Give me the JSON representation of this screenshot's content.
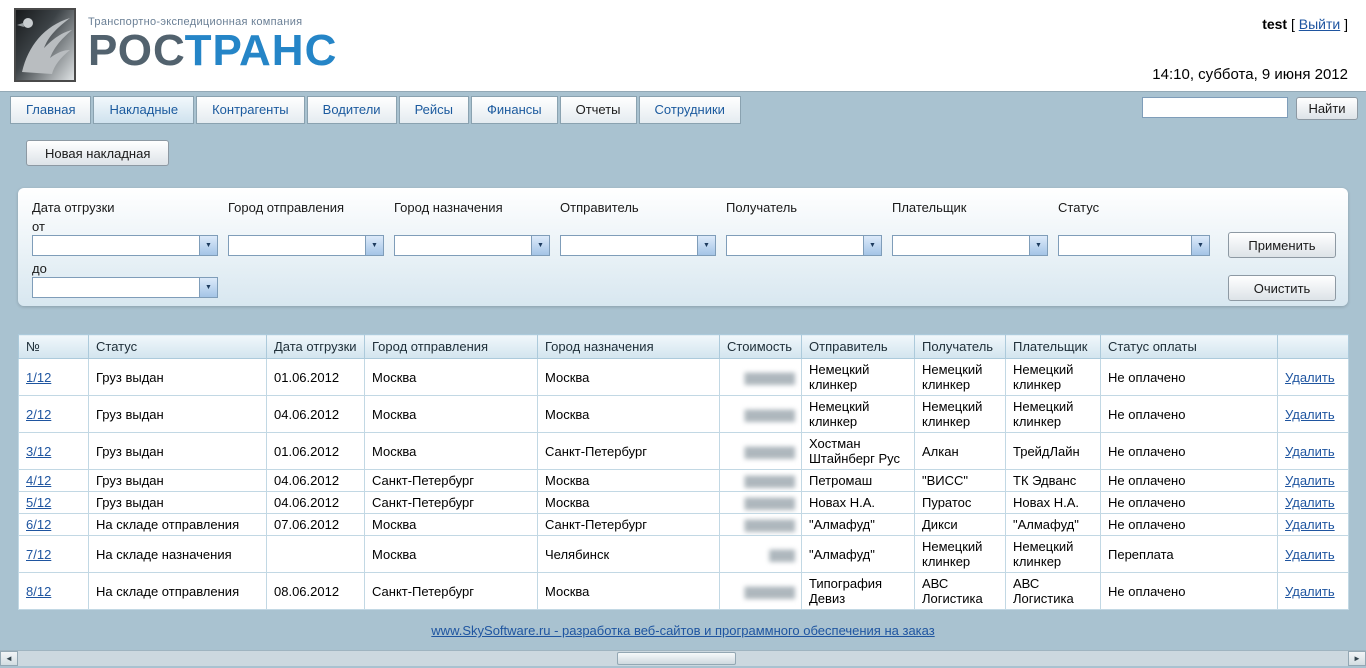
{
  "header": {
    "tagline": "Транспортно-экспедиционная компания",
    "brand_ros": "РОС",
    "brand_trans": "ТРАНС",
    "user": "test",
    "bracket_left": "[",
    "logout_label": "Выйти",
    "bracket_right": "]",
    "datetime": "14:10, суббота, 9 июня 2012"
  },
  "tabs": [
    {
      "label": "Главная"
    },
    {
      "label": "Накладные",
      "active": true
    },
    {
      "label": "Контрагенты"
    },
    {
      "label": "Водители"
    },
    {
      "label": "Рейсы"
    },
    {
      "label": "Финансы"
    },
    {
      "label": "Отчеты"
    },
    {
      "label": "Сотрудники"
    }
  ],
  "search": {
    "value": "",
    "button_label": "Найти"
  },
  "toolbar": {
    "new_invoice_label": "Новая накладная"
  },
  "filters": {
    "date_label": "Дата отгрузки",
    "from_label": "от",
    "to_label": "до",
    "origin_label": "Город отправления",
    "destination_label": "Город назначения",
    "sender_label": "Отправитель",
    "receiver_label": "Получатель",
    "payer_label": "Плательщик",
    "status_label": "Статус",
    "apply_label": "Применить",
    "clear_label": "Очистить"
  },
  "icons": {
    "dropdown_arrow": "▼",
    "scroll_left": "◄",
    "scroll_right": "►"
  },
  "table": {
    "headers": [
      "№",
      "Статус",
      "Дата отгрузки",
      "Город отправления",
      "Город назначения",
      "Стоимость",
      "Отправитель",
      "Получатель",
      "Плательщик",
      "Статус оплаты",
      ""
    ],
    "delete_label": "Удалить",
    "rows": [
      {
        "num": "1/12",
        "status": "Груз выдан",
        "date": "01.06.2012",
        "from": "Москва",
        "to": "Москва",
        "cost": "▇▇▇▇▇▇",
        "sender": "Немецкий клинкер",
        "receiver": "Немецкий клинкер",
        "payer": "Немецкий клинкер",
        "payment_status": "Не оплачено"
      },
      {
        "num": "2/12",
        "status": "Груз выдан",
        "date": "04.06.2012",
        "from": "Москва",
        "to": "Москва",
        "cost": "▇▇▇▇▇▇",
        "sender": "Немецкий клинкер",
        "receiver": "Немецкий клинкер",
        "payer": "Немецкий клинкер",
        "payment_status": "Не оплачено"
      },
      {
        "num": "3/12",
        "status": "Груз выдан",
        "date": "01.06.2012",
        "from": "Москва",
        "to": "Санкт-Петербург",
        "cost": "▇▇▇▇▇▇",
        "sender": "Хостман Штайнберг Рус",
        "receiver": "Алкан",
        "payer": "ТрейдЛайн",
        "payment_status": "Не оплачено"
      },
      {
        "num": "4/12",
        "status": "Груз выдан",
        "date": "04.06.2012",
        "from": "Санкт-Петербург",
        "to": "Москва",
        "cost": "▇▇▇▇▇▇",
        "sender": "Петромаш",
        "receiver": "\"ВИСС\"",
        "payer": "ТК Эдванс",
        "payment_status": "Не оплачено"
      },
      {
        "num": "5/12",
        "status": "Груз выдан",
        "date": "04.06.2012",
        "from": "Санкт-Петербург",
        "to": "Москва",
        "cost": "▇▇▇▇▇▇",
        "sender": "Новах Н.А.",
        "receiver": "Пуратос",
        "payer": "Новах Н.А.",
        "payment_status": "Не оплачено"
      },
      {
        "num": "6/12",
        "status": "На складе отправления",
        "date": "07.06.2012",
        "from": "Москва",
        "to": "Санкт-Петербург",
        "cost": "▇▇▇▇▇▇",
        "sender": "\"Алмафуд\"",
        "receiver": "Дикси",
        "payer": "\"Алмафуд\"",
        "payment_status": "Не оплачено"
      },
      {
        "num": "7/12",
        "status": "На складе назначения",
        "date": "",
        "from": "Москва",
        "to": "Челябинск",
        "cost": "▇▇▇",
        "sender": "\"Алмафуд\"",
        "receiver": "Немецкий клинкер",
        "payer": "Немецкий клинкер",
        "payment_status": "Переплата"
      },
      {
        "num": "8/12",
        "status": "На складе отправления",
        "date": "08.06.2012",
        "from": "Санкт-Петербург",
        "to": "Москва",
        "cost": "▇▇▇▇▇▇",
        "sender": "Типография Девиз",
        "receiver": "АВС Логистика",
        "payer": "АВС Логистика",
        "payment_status": "Не оплачено"
      }
    ]
  },
  "footer": {
    "link": "www.SkySoftware.ru - разработка веб-сайтов и программного обеспечения на заказ"
  }
}
